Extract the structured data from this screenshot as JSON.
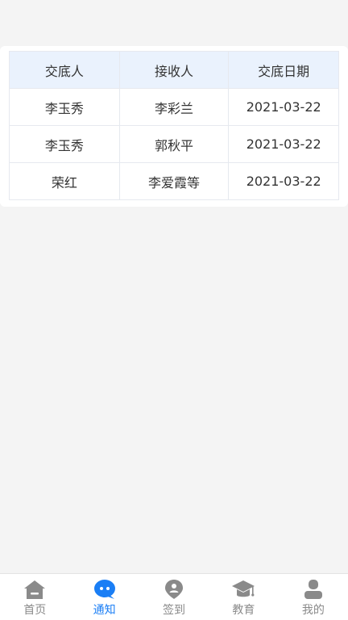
{
  "table": {
    "headers": [
      "交底人",
      "接收人",
      "交底日期"
    ],
    "rows": [
      [
        "李玉秀",
        "李彩兰",
        "2021-03-22"
      ],
      [
        "李玉秀",
        "郭秋平",
        "2021-03-22"
      ],
      [
        "荣红",
        "李爱霞等",
        "2021-03-22"
      ]
    ]
  },
  "tabbar": {
    "active_color": "#1a7ef5",
    "inactive_color": "#8a8a8a",
    "items": [
      {
        "label": "首页",
        "icon": "home-icon"
      },
      {
        "label": "通知",
        "icon": "chat-bubble-icon",
        "active": true
      },
      {
        "label": "签到",
        "icon": "location-pin-icon"
      },
      {
        "label": "教育",
        "icon": "graduation-cap-icon"
      },
      {
        "label": "我的",
        "icon": "user-icon"
      }
    ]
  }
}
